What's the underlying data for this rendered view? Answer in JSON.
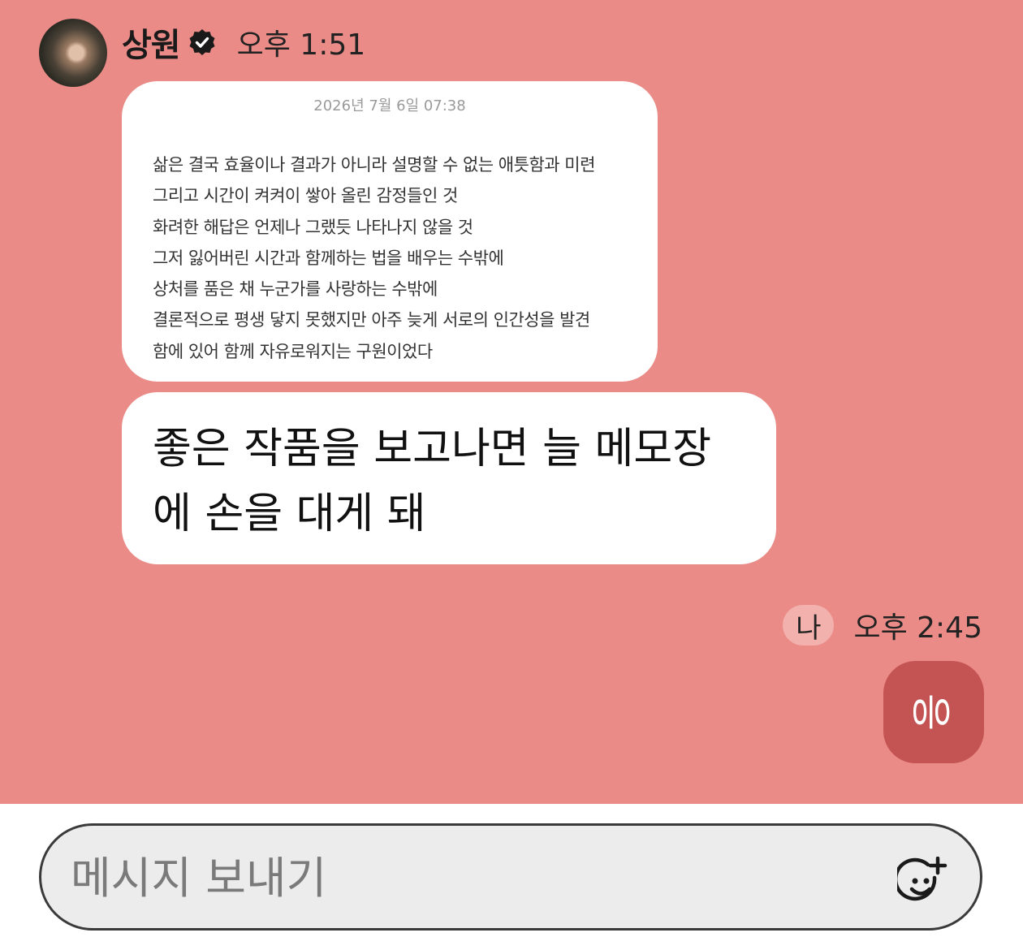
{
  "sender": {
    "name": "상원",
    "time": "오후 1:51"
  },
  "memo": {
    "date": "2026년 7월 6일 07:38",
    "lines": [
      "삶은 결국 효율이나 결과가 아니라 설명할 수 없는 애틋함과 미련",
      "그리고 시간이 켜켜이 쌓아 올린 감정들인 것",
      "화려한 해답은 언제나 그랬듯 나타나지 않을 것",
      "그저 잃어버린 시간과 함께하는 법을 배우는 수밖에",
      "상처를 품은 채 누군가를 사랑하는 수밖에",
      "결론적으로 평생 닿지 못했지만 아주 늦게 서로의 인간성을 발견",
      "함에 있어 함께 자유로워지는 구원이었다"
    ]
  },
  "message": {
    "line1": "좋은 작품을 보고나면 늘 메모장",
    "line2": "에 손을 대게 돼"
  },
  "me": {
    "label": "나",
    "time": "오후 2:45",
    "reply": "응"
  },
  "input": {
    "placeholder": "메시지 보내기"
  },
  "colors": {
    "chat_background": "#ea8b87",
    "reply_bubble": "#c45353",
    "me_badge": "#f2b1ac"
  },
  "icons": {
    "verified": "verified-badge-icon",
    "emoji": "add-emoji-icon"
  }
}
